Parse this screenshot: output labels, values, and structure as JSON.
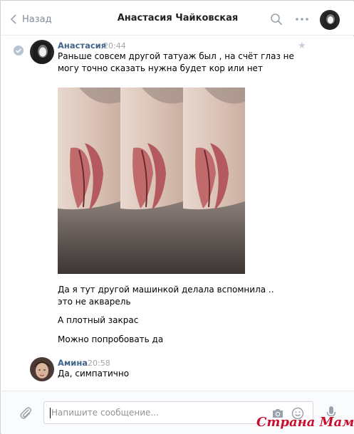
{
  "header": {
    "back_label": "Назад",
    "title": "Анастасия Чайковская"
  },
  "messages": [
    {
      "author": "Анастасия",
      "time": "20:44",
      "lines": [
        "Раньше совсем другой татуаж был , на счёт глаз не могу точно сказать нужна будет кор или нет",
        "Да я тут другой машинкой делала вспомнила .. это не акварель",
        "А плотный закрас",
        "Можно попробовать да"
      ]
    },
    {
      "author": "Амина",
      "time": "20:58",
      "lines": [
        "Да, симпатично"
      ]
    }
  ],
  "composer": {
    "placeholder": "Напишите сообщение..."
  },
  "watermark": "Страна Мам",
  "colors": {
    "link": "#42648b",
    "muted": "#828a99",
    "watermark": "#c8102e"
  },
  "icons": [
    "chevron-left-icon",
    "search-icon",
    "more-icon",
    "star-icon",
    "read-check-icon",
    "paperclip-icon",
    "camera-icon",
    "smile-icon",
    "microphone-icon"
  ]
}
